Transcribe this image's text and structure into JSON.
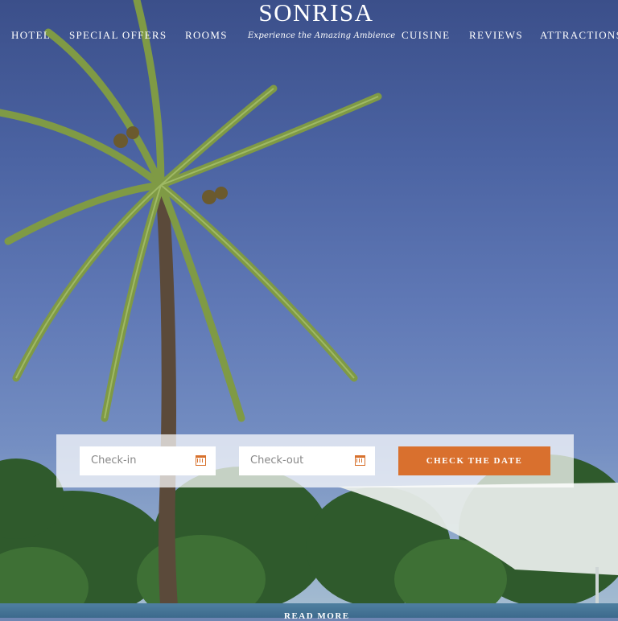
{
  "brand": {
    "name": "SONRISA",
    "tagline": "Experience the Amazing Ambience"
  },
  "nav": {
    "items": [
      "HOTEL",
      "SPECIAL OFFERS",
      "ROOMS",
      "CUISINE",
      "REVIEWS",
      "ATTRACTIONS"
    ]
  },
  "booking": {
    "checkin_placeholder": "Check-in",
    "checkout_placeholder": "Check-out",
    "submit_label": "CHECK THE DATE"
  },
  "hero": {
    "read_more": "READ MORE"
  },
  "colors": {
    "accent": "#d9702e",
    "sky": "#4b63a2"
  },
  "icons": [
    "calendar-icon",
    "sun-logo-icon"
  ]
}
